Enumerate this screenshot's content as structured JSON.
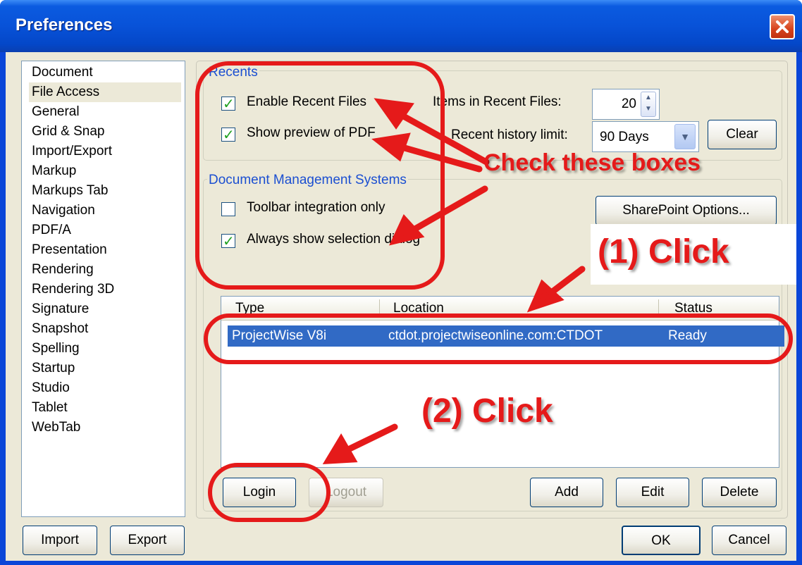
{
  "window": {
    "title": "Preferences"
  },
  "sidebar": {
    "items": [
      {
        "label": "Document"
      },
      {
        "label": "File Access",
        "selected": true
      },
      {
        "label": "General"
      },
      {
        "label": "Grid & Snap"
      },
      {
        "label": "Import/Export"
      },
      {
        "label": "Markup"
      },
      {
        "label": "Markups Tab"
      },
      {
        "label": "Navigation"
      },
      {
        "label": "PDF/A"
      },
      {
        "label": "Presentation"
      },
      {
        "label": "Rendering"
      },
      {
        "label": "Rendering 3D"
      },
      {
        "label": "Signature"
      },
      {
        "label": "Snapshot"
      },
      {
        "label": "Spelling"
      },
      {
        "label": "Startup"
      },
      {
        "label": "Studio"
      },
      {
        "label": "Tablet"
      },
      {
        "label": "WebTab"
      }
    ]
  },
  "recents": {
    "group_label": "Recents",
    "enable_recent_files": {
      "label": "Enable Recent Files",
      "checked": true
    },
    "show_preview": {
      "label": "Show preview of PDF",
      "checked": true
    },
    "items_label": "Items in Recent Files:",
    "items_value": "20",
    "history_label": "Recent history limit:",
    "history_value": "90 Days",
    "clear_label": "Clear"
  },
  "dms": {
    "group_label": "Document Management Systems",
    "toolbar_only": {
      "label": "Toolbar integration only",
      "checked": false
    },
    "always_show": {
      "label": "Always show selection dialog",
      "checked": true
    },
    "sharepoint_label": "SharePoint Options...",
    "columns": [
      "Type",
      "Location",
      "Status"
    ],
    "rows": [
      {
        "type": "ProjectWise V8i",
        "location": "ctdot.projectwiseonline.com:CTDOT",
        "status": "Ready",
        "selected": true
      }
    ],
    "login_label": "Login",
    "logout_label": "Logout",
    "add_label": "Add",
    "edit_label": "Edit",
    "delete_label": "Delete"
  },
  "footer": {
    "import_label": "Import",
    "export_label": "Export",
    "ok_label": "OK",
    "cancel_label": "Cancel"
  },
  "annotations": {
    "check_boxes": "Check these boxes",
    "click_1": "(1) Click",
    "click_2": "(2) Click",
    "color": "#e51a1a"
  },
  "colors": {
    "title_bar": "#0a46d8",
    "dialog_bg": "#ece9d8",
    "group_label": "#1b4fd1",
    "selection": "#316ac5"
  }
}
